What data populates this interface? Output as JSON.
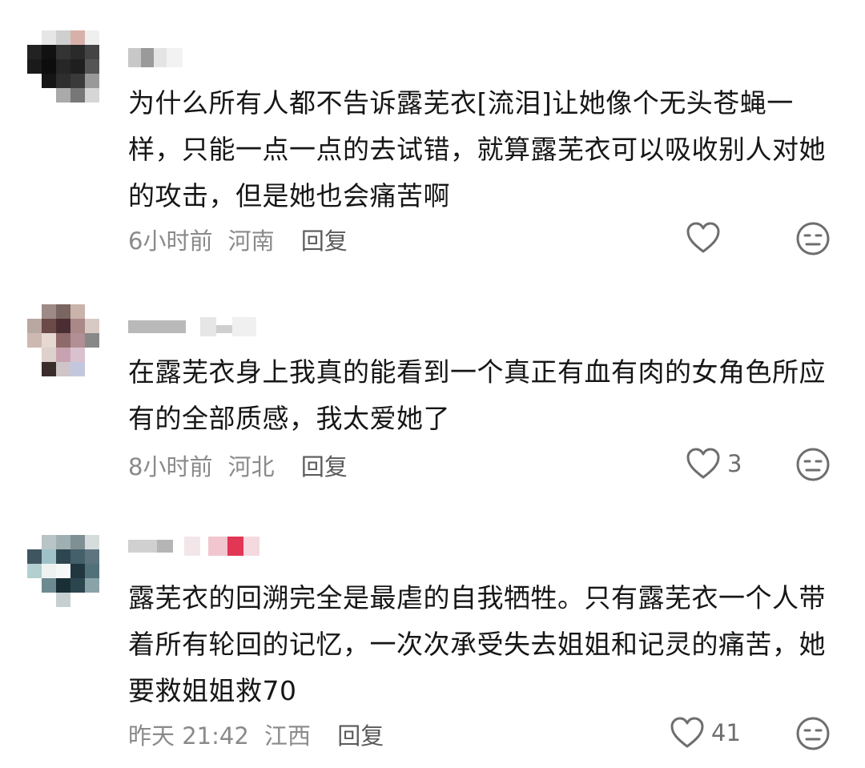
{
  "comments": [
    {
      "text": "为什么所有人都不告诉露芜衣[流泪]让她像个无头苍蝇一样，只能一点一点的去试错，就算露芜衣可以吸收别人对她的攻击，但是她也会痛苦啊",
      "time": "6小时前",
      "location": "河南",
      "reply": "回复",
      "likes": ""
    },
    {
      "text": "在露芜衣身上我真的能看到一个真正有血有肉的女角色所应有的全部质感，我太爱她了",
      "time": "8小时前",
      "location": "河北",
      "reply": "回复",
      "likes": "3"
    },
    {
      "text": "露芜衣的回溯完全是最虐的自我牺牲。只有露芜衣一个人带着所有轮回的记忆，一次次承受失去姐姐和记灵的痛苦，她要救姐姐救70",
      "time": "昨天 21:42",
      "location": "江西",
      "reply": "回复",
      "likes": "41"
    }
  ],
  "icons": {
    "like": "heart-outline-icon",
    "dislike": "neutral-face-icon"
  },
  "colors": {
    "text": "#161616",
    "meta": "#8a8a8a",
    "icon": "#6e6e6e"
  }
}
